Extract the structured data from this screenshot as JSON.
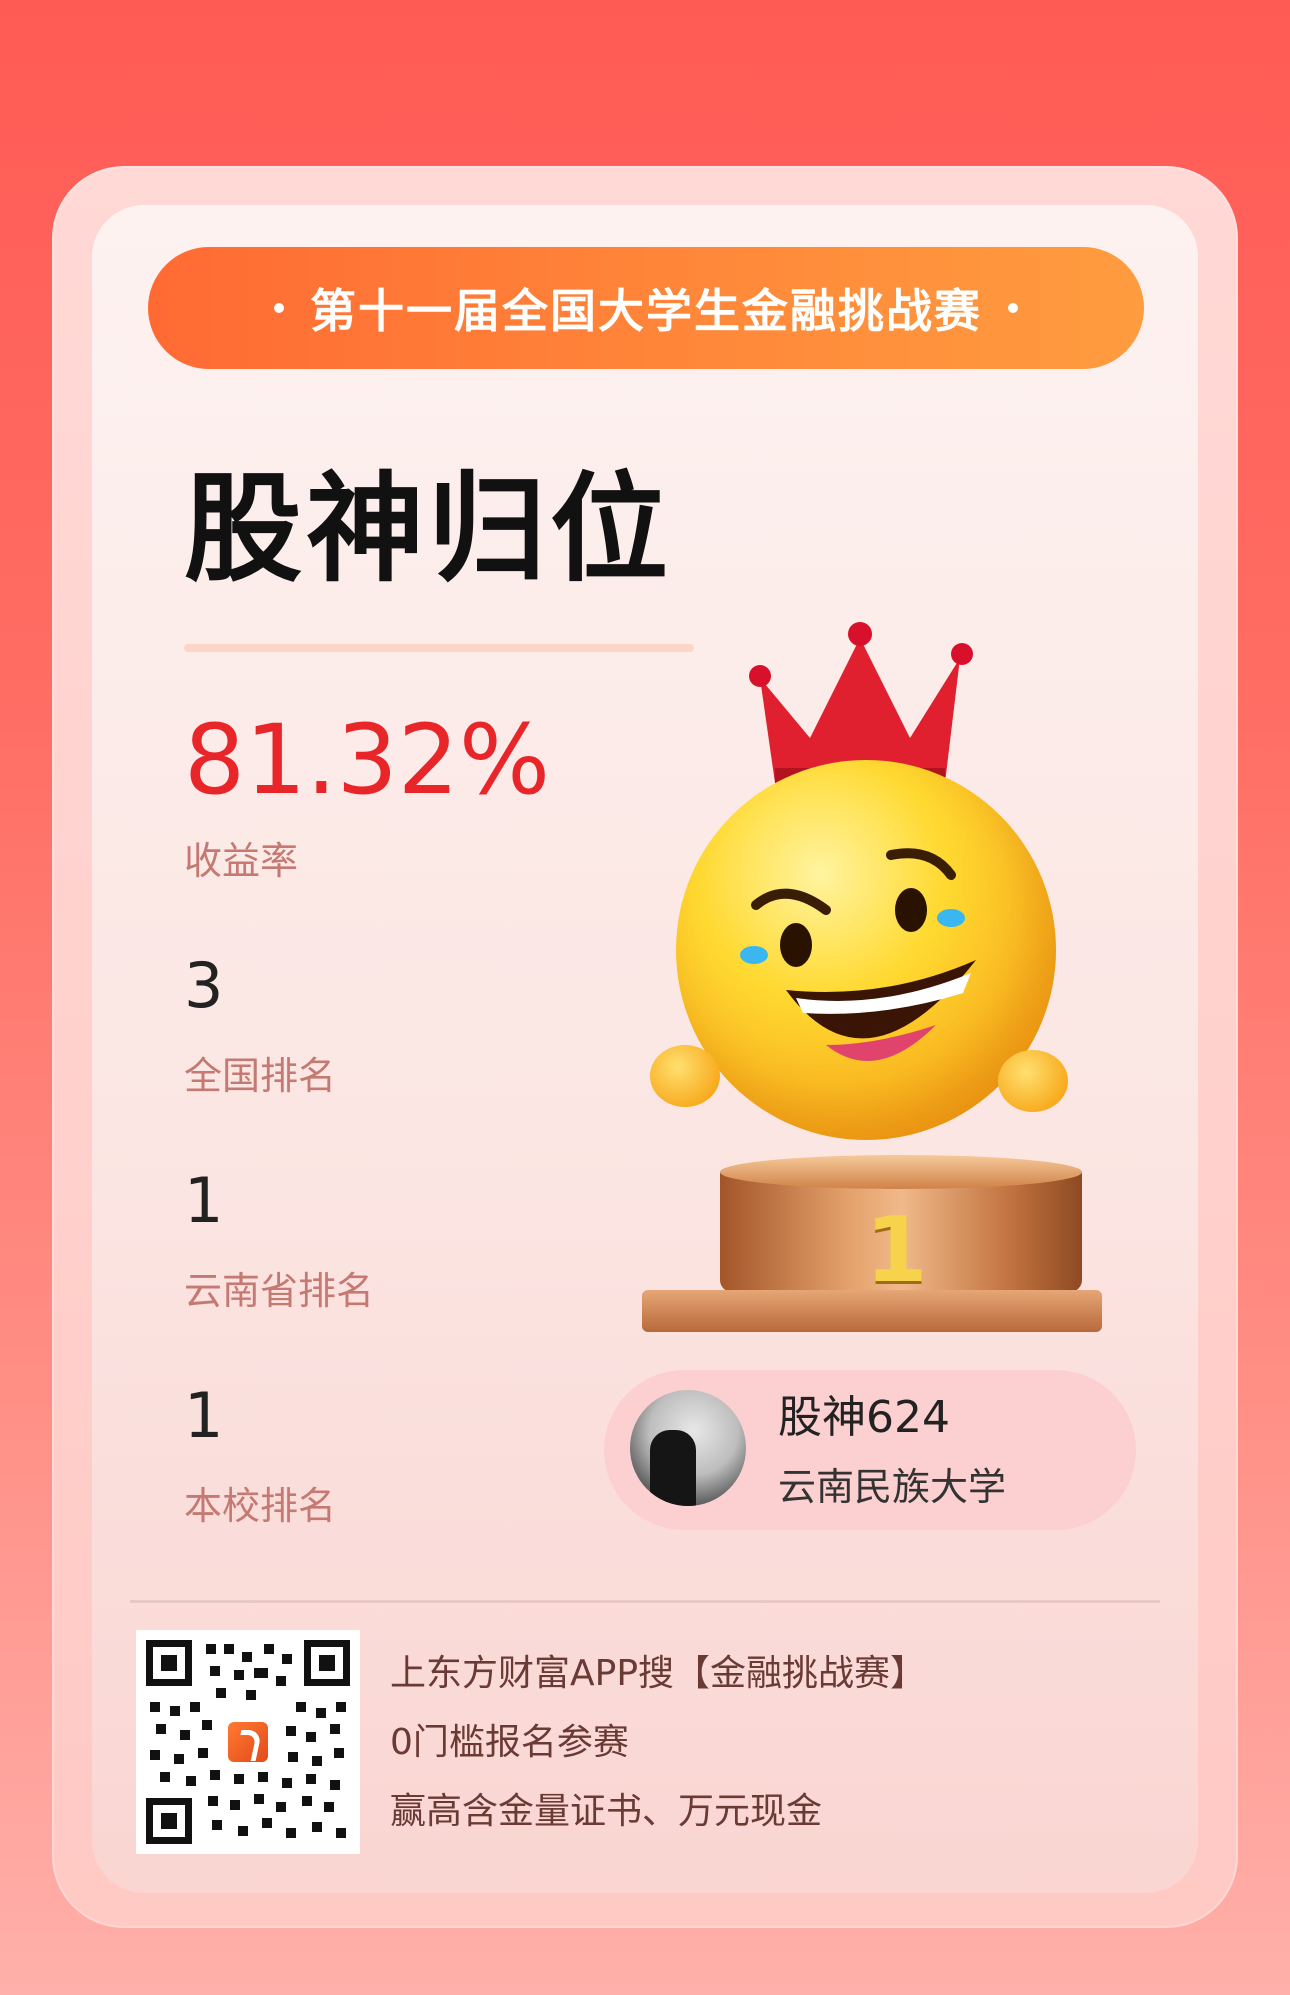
{
  "banner": {
    "title": "第十一届全国大学生金融挑战赛"
  },
  "headline": "股神归位",
  "stats": {
    "yield_value": "81.32%",
    "yield_label": "收益率",
    "national_rank_value": "3",
    "national_rank_label": "全国排名",
    "province_rank_value": "1",
    "province_rank_label": "云南省排名",
    "school_rank_value": "1",
    "school_rank_label": "本校排名"
  },
  "podium": {
    "rank_number": "1"
  },
  "profile": {
    "name": "股神624",
    "school": "云南民族大学"
  },
  "promo": {
    "line1": "上东方财富APP搜【金融挑战赛】",
    "line2": "0门槛报名参赛",
    "line3": "赢高含金量证书、万元现金"
  },
  "colors": {
    "background": "#ff5b55",
    "banner": "#ff7a35",
    "yield": "#e8262a",
    "label": "#c47a72"
  },
  "icons": {
    "mascot": "smiley-crown-icon",
    "qr": "qr-code-icon",
    "app_logo": "eastmoney-logo-icon"
  }
}
